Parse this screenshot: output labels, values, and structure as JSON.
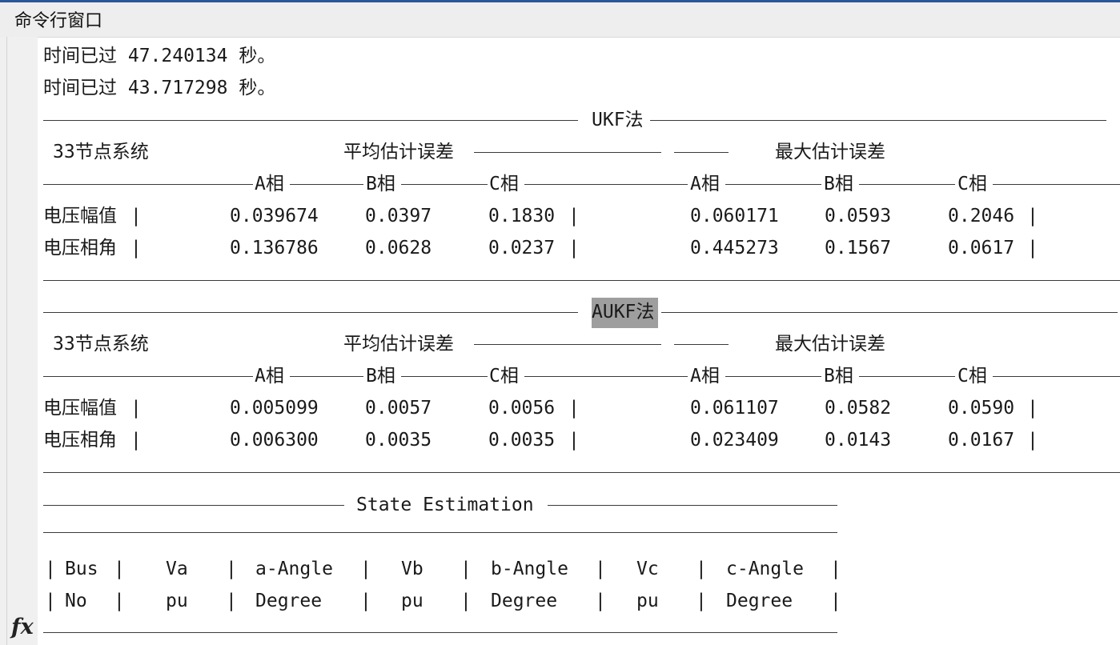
{
  "window": {
    "title": "命令行窗口"
  },
  "prompt_icon": "fx",
  "log": [
    "时间已过 47.240134 秒。",
    "时间已过 43.717298 秒。"
  ],
  "ukf": {
    "method": "UKF法",
    "system": "33节点系统",
    "mean_error": "平均估计误差",
    "max_error": "最大估计误差",
    "phases": [
      "A相",
      "B相",
      "C相",
      "A相",
      "B相",
      "C相"
    ],
    "rows": [
      {
        "label": "电压幅值",
        "values": [
          "0.039674",
          "0.0397",
          "0.1830",
          "0.060171",
          "0.0593",
          "0.2046"
        ]
      },
      {
        "label": "电压相角",
        "values": [
          "0.136786",
          "0.0628",
          "0.0237",
          "0.445273",
          "0.1567",
          "0.0617"
        ]
      }
    ]
  },
  "aukf": {
    "method": "AUKF法",
    "system": "33节点系统",
    "mean_error": "平均估计误差",
    "max_error": "最大估计误差",
    "phases": [
      "A相",
      "B相",
      "C相",
      "A相",
      "B相",
      "C相"
    ],
    "rows": [
      {
        "label": "电压幅值",
        "values": [
          "0.005099",
          "0.0057",
          "0.0056",
          "0.061107",
          "0.0582",
          "0.0590"
        ]
      },
      {
        "label": "电压相角",
        "values": [
          "0.006300",
          "0.0035",
          "0.0035",
          "0.023409",
          "0.0143",
          "0.0167"
        ]
      }
    ]
  },
  "state_estimation": {
    "title": "State Estimation",
    "headers": [
      "Bus",
      "Va",
      "a-Angle",
      "Vb",
      "b-Angle",
      "Vc",
      "c-Angle"
    ],
    "units": [
      "No",
      "pu",
      "Degree",
      "pu",
      "Degree",
      "pu",
      "Degree"
    ]
  },
  "colors": {
    "highlight": "#9e9e9e",
    "title_bar": "#eeeeee",
    "gutter": "#f0f0f0",
    "accent": "#2b5797"
  }
}
